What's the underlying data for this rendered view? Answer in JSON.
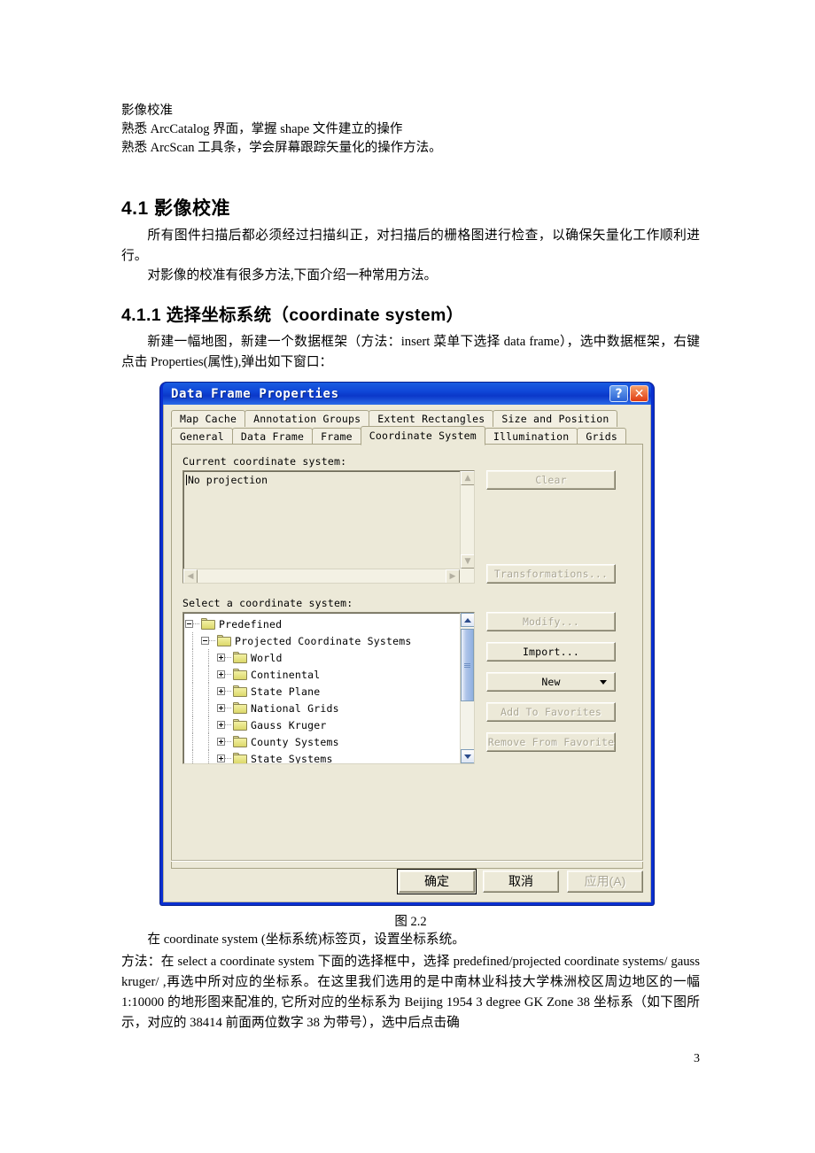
{
  "document": {
    "intro_lines": [
      "影像校准",
      "熟悉 ArcCatalog 界面，掌握 shape 文件建立的操作",
      "熟悉 ArcScan 工具条，学会屏幕跟踪矢量化的操作方法。"
    ],
    "section_heading": "4.1 影像校准",
    "para1": "所有图件扫描后都必须经过扫描纠正，对扫描后的栅格图进行检查，以确保矢量化工作顺利进行。",
    "para2": "对影像的校准有很多方法,下面介绍一种常用方法。",
    "subsection_heading": "4.1.1 选择坐标系统（coordinate system）",
    "para3": "新建一幅地图，新建一个数据框架（方法：insert 菜单下选择 data frame），选中数据框架，右键点击 Properties(属性),弹出如下窗口：",
    "figure_caption": "图 2.2",
    "para4": "在 coordinate system (坐标系统)标签页，设置坐标系统。",
    "para5": "方法：在 select a coordinate system 下面的选择框中，选择 predefined/projected coordinate systems/ gauss kruger/ ,再选中所对应的坐标系。在这里我们选用的是中南林业科技大学株洲校区周边地区的一幅 1:10000 的地形图来配准的, 它所对应的坐标系为 Beijing 1954 3 degree GK Zone 38 坐标系（如下图所示，对应的 38414 前面两位数字 38 为带号），选中后点击确",
    "page_number": "3"
  },
  "dialog": {
    "title": "Data Frame Properties",
    "help_button": "?",
    "close_button": "✕",
    "tabs_row1": [
      {
        "label": "Map Cache",
        "active": false
      },
      {
        "label": "Annotation Groups",
        "active": false
      },
      {
        "label": "Extent Rectangles",
        "active": false
      },
      {
        "label": "Size and Position",
        "active": false
      }
    ],
    "tabs_row2": [
      {
        "label": "General",
        "active": false
      },
      {
        "label": "Data Frame",
        "active": false
      },
      {
        "label": "Frame",
        "active": false
      },
      {
        "label": "Coordinate System",
        "active": true
      },
      {
        "label": "Illumination",
        "active": false
      },
      {
        "label": "Grids",
        "active": false
      }
    ],
    "current_cs": {
      "label": "Current coordinate system:",
      "value": "No projection"
    },
    "side_buttons_top": [
      {
        "label": "Clear",
        "disabled": true
      },
      {
        "label": "Transformations...",
        "disabled": true
      }
    ],
    "select_cs": {
      "label": "Select a coordinate system:",
      "tree": [
        {
          "label": "Predefined",
          "depth": 0,
          "state": "minus"
        },
        {
          "label": "Projected Coordinate Systems",
          "depth": 1,
          "state": "minus"
        },
        {
          "label": "World",
          "depth": 2,
          "state": "plus"
        },
        {
          "label": "Continental",
          "depth": 2,
          "state": "plus"
        },
        {
          "label": "State Plane",
          "depth": 2,
          "state": "plus"
        },
        {
          "label": "National Grids",
          "depth": 2,
          "state": "plus"
        },
        {
          "label": "Gauss Kruger",
          "depth": 2,
          "state": "plus"
        },
        {
          "label": "County Systems",
          "depth": 2,
          "state": "plus"
        },
        {
          "label": "State Systems",
          "depth": 2,
          "state": "plus"
        }
      ]
    },
    "side_buttons_bottom": [
      {
        "label": "Modify...",
        "disabled": true,
        "dropdown": false
      },
      {
        "label": "Import...",
        "disabled": false,
        "dropdown": false
      },
      {
        "label": "New",
        "disabled": false,
        "dropdown": true
      },
      {
        "label": "Add To Favorites",
        "disabled": true,
        "dropdown": false
      },
      {
        "label": "Remove From Favorite",
        "disabled": true,
        "dropdown": false
      }
    ],
    "footer_buttons": [
      {
        "label": "确定",
        "disabled": false,
        "default": true
      },
      {
        "label": "取消",
        "disabled": false,
        "default": false
      },
      {
        "label": "应用(A)",
        "disabled": true,
        "default": false
      }
    ]
  },
  "colors": {
    "titlebar": "#0b37c9",
    "dialog_face": "#ece9d8",
    "border": "#a9a487",
    "close_button": "#e03a12"
  }
}
